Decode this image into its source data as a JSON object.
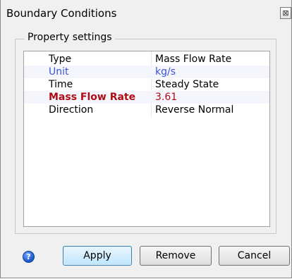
{
  "window": {
    "title": "Boundary Conditions",
    "close_glyph": "⊠"
  },
  "group": {
    "legend": "Property settings"
  },
  "properties": [
    {
      "name": "Type",
      "value": "Mass Flow Rate",
      "style": "normal"
    },
    {
      "name": "Unit",
      "value": "kg/s",
      "style": "blue"
    },
    {
      "name": "Time",
      "value": "Steady State",
      "style": "normal"
    },
    {
      "name": "Mass Flow Rate",
      "value": "3.61",
      "style": "red-bold"
    },
    {
      "name": "Direction",
      "value": "Reverse Normal",
      "style": "normal"
    }
  ],
  "footer": {
    "help_glyph": "?",
    "apply_label": "Apply",
    "remove_label": "Remove",
    "cancel_label": "Cancel"
  },
  "colors": {
    "unit_text": "#3a55d6",
    "highlight_text": "#b00b14"
  }
}
